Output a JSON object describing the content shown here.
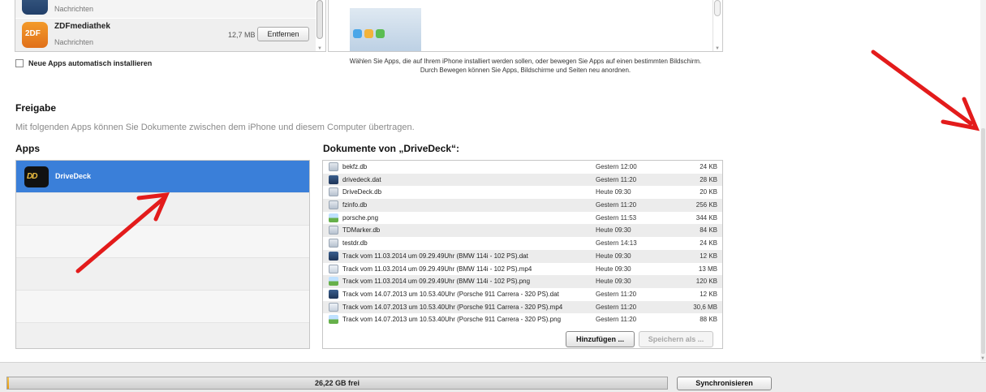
{
  "top_apps": [
    {
      "name": "",
      "category": "Nachrichten",
      "size": "",
      "button": "",
      "icon": "news-app-icon"
    },
    {
      "name": "ZDFmediathek",
      "category": "Nachrichten",
      "size": "12,7 MB",
      "button": "Entfernen",
      "icon": "zdf-app-icon",
      "icon_text": "2DF"
    }
  ],
  "auto_install_label": "Neue Apps automatisch installieren",
  "home_caption_1": "Wählen Sie Apps, die auf Ihrem iPhone installiert werden sollen, oder bewegen Sie Apps auf einen bestimmten Bildschirm.",
  "home_caption_2": "Durch Bewegen können Sie Apps, Bildschirme und Seiten neu anordnen.",
  "sharing": {
    "title": "Freigabe",
    "description": "Mit folgenden Apps können Sie Dokumente zwischen dem iPhone und diesem Computer übertragen.",
    "apps_heading": "Apps",
    "docs_heading": "Dokumente von „DriveDeck“:",
    "selected_app": "DriveDeck",
    "documents": [
      {
        "name": "bekfz.db",
        "date": "Gestern 12:00",
        "size": "24 KB",
        "type": "db"
      },
      {
        "name": "drivedeck.dat",
        "date": "Gestern 11:20",
        "size": "28 KB",
        "type": "dat"
      },
      {
        "name": "DriveDeck.db",
        "date": "Heute 09:30",
        "size": "20 KB",
        "type": "db"
      },
      {
        "name": "fzinfo.db",
        "date": "Gestern 11:20",
        "size": "256 KB",
        "type": "db"
      },
      {
        "name": "porsche.png",
        "date": "Gestern 11:53",
        "size": "344 KB",
        "type": "png"
      },
      {
        "name": "TDMarker.db",
        "date": "Heute 09:30",
        "size": "84 KB",
        "type": "db"
      },
      {
        "name": "testdr.db",
        "date": "Gestern 14:13",
        "size": "24 KB",
        "type": "db"
      },
      {
        "name": "Track vom 11.03.2014 um 09.29.49Uhr (BMW 114i - 102 PS).dat",
        "date": "Heute 09:30",
        "size": "12 KB",
        "type": "dat"
      },
      {
        "name": "Track vom 11.03.2014 um 09.29.49Uhr (BMW 114i - 102 PS).mp4",
        "date": "Heute 09:30",
        "size": "13 MB",
        "type": "mp4"
      },
      {
        "name": "Track vom 11.03.2014 um 09.29.49Uhr (BMW 114i - 102 PS).png",
        "date": "Heute 09:30",
        "size": "120 KB",
        "type": "png"
      },
      {
        "name": "Track vom 14.07.2013 um 10.53.40Uhr (Porsche 911 Carrera - 320 PS).dat",
        "date": "Gestern 11:20",
        "size": "12 KB",
        "type": "dat"
      },
      {
        "name": "Track vom 14.07.2013 um 10.53.40Uhr (Porsche 911 Carrera - 320 PS).mp4",
        "date": "Gestern 11:20",
        "size": "30,6 MB",
        "type": "mp4"
      },
      {
        "name": "Track vom 14.07.2013 um 10.53.40Uhr (Porsche 911 Carrera - 320 PS).png",
        "date": "Gestern 11:20",
        "size": "88 KB",
        "type": "png"
      }
    ],
    "add_button": "Hinzufügen ...",
    "save_button": "Speichern als ..."
  },
  "capacity": {
    "free_label": "26,22 GB frei",
    "used_fraction": 0.002
  },
  "sync_button": "Synchronisieren",
  "colors": {
    "selection": "#3a7fd9",
    "arrow": "#e31b1b",
    "capacity_used": "#f0a81c"
  }
}
